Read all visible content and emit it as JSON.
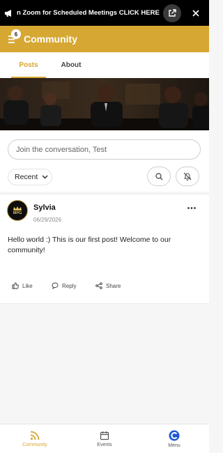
{
  "announcement": {
    "text": "n Zoom for Scheduled Meetings CLICK HERE",
    "icons": [
      "megaphone-icon",
      "external-link-icon",
      "close-icon"
    ]
  },
  "header": {
    "title": "Community",
    "menu_badge": "6"
  },
  "tabs": [
    {
      "label": "Posts",
      "active": true
    },
    {
      "label": "About",
      "active": false
    }
  ],
  "composer": {
    "placeholder": "Join the conversation, Test"
  },
  "sort": {
    "label": "Recent"
  },
  "post": {
    "author": "Sylvia",
    "avatar_text": "MPG",
    "date": "06/29/2026",
    "body": "Hello world :) This is our first post! Welcome to our community!",
    "actions": {
      "like": "Like",
      "reply": "Reply",
      "share": "Share"
    }
  },
  "bottom_nav": [
    {
      "label": "Community",
      "icon": "rss-icon",
      "active": true
    },
    {
      "label": "Events",
      "icon": "calendar-icon",
      "active": false
    },
    {
      "label": "Menu",
      "icon": "app-logo-icon",
      "active": false
    }
  ],
  "colors": {
    "accent": "#d6a733",
    "announcement_bg": "#000000",
    "active_nav": "#d6a733",
    "menu_logo": "#1f57d6"
  }
}
